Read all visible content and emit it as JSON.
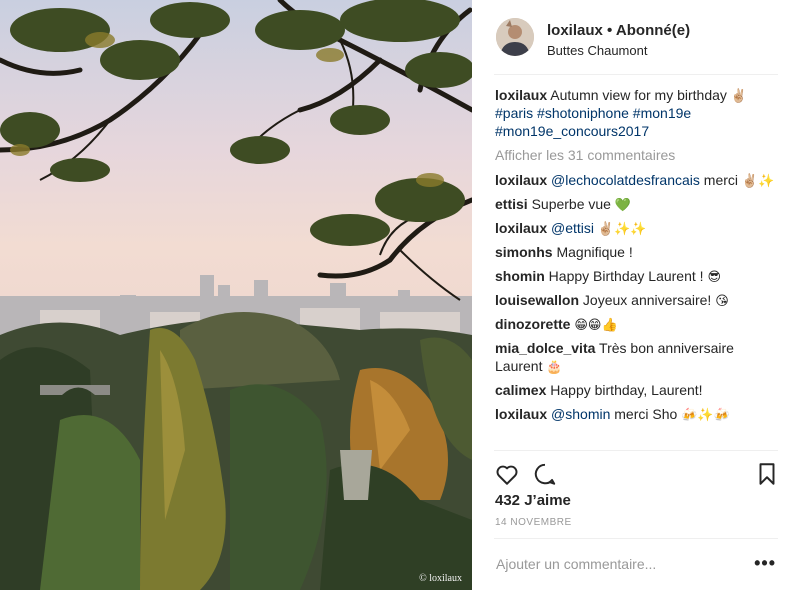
{
  "header": {
    "username": "loxilaux",
    "separator": "•",
    "follow_status": "Abonné(e)",
    "location": "Buttes Chaumont"
  },
  "photo": {
    "credit": "© loxilaux"
  },
  "caption": {
    "username": "loxilaux",
    "text": "Autumn view for my birthday",
    "emoji": "✌🏼",
    "hashtags": [
      "#paris",
      "#shotoniphone",
      "#mon19e",
      "#mon19e_concours2017"
    ]
  },
  "view_more": "Afficher les 31 commentaires",
  "comments": [
    {
      "username": "loxilaux",
      "mention": "@lechocolatdesfrancais",
      "text": "merci",
      "emoji": "✌🏼✨"
    },
    {
      "username": "ettisi",
      "mention": "",
      "text": "Superbe vue",
      "emoji": "💚"
    },
    {
      "username": "loxilaux",
      "mention": "@ettisi",
      "text": "",
      "emoji": "✌🏼✨✨"
    },
    {
      "username": "simonhs",
      "mention": "",
      "text": "Magnifique !",
      "emoji": ""
    },
    {
      "username": "shomin",
      "mention": "",
      "text": "Happy Birthday Laurent !",
      "emoji": "😎"
    },
    {
      "username": "louisewallon",
      "mention": "",
      "text": "Joyeux anniversaire!",
      "emoji": "😘"
    },
    {
      "username": "dinozorette",
      "mention": "",
      "text": "",
      "emoji": "😁😁👍"
    },
    {
      "username": "mia_dolce_vita",
      "mention": "",
      "text": "Très bon anniversaire Laurent",
      "emoji": "🎂"
    },
    {
      "username": "calimex",
      "mention": "",
      "text": "Happy birthday, Laurent!",
      "emoji": ""
    },
    {
      "username": "loxilaux",
      "mention": "@shomin",
      "text": "merci Sho",
      "emoji": "🍻✨🍻"
    }
  ],
  "actions": {
    "like_icon": "heart-icon",
    "comment_icon": "comment-icon",
    "save_icon": "bookmark-icon"
  },
  "likes": "432 J’aime",
  "date": "14 NOVEMBRE",
  "add_comment": {
    "placeholder": "Ajouter un commentaire...",
    "more_label": "•••"
  },
  "colors": {
    "link": "#003569",
    "muted": "#999999",
    "text": "#262626",
    "divider": "#efefef"
  }
}
